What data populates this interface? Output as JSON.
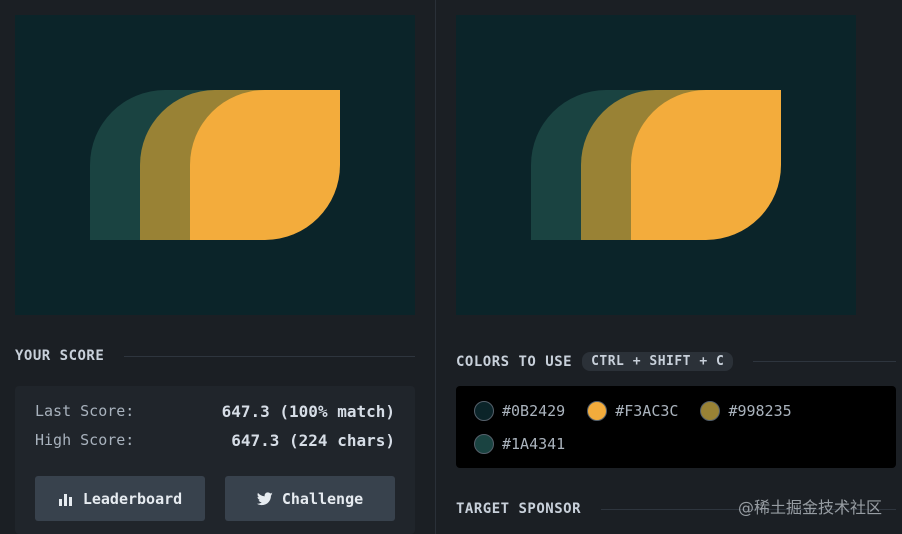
{
  "colors": {
    "bg": "#0B2429",
    "c1": "#1A4341",
    "c2": "#998235",
    "c3": "#F3AC3C"
  },
  "score": {
    "title": "YOUR SCORE",
    "last_label": "Last Score:",
    "last_value": "647.3 (100% match)",
    "high_label": "High Score:",
    "high_value": "647.3 (224 chars)"
  },
  "buttons": {
    "leaderboard": "Leaderboard",
    "challenge": "Challenge"
  },
  "palette": {
    "title": "COLORS TO USE",
    "shortcut": "CTRL + SHIFT + C",
    "items": [
      "#0B2429",
      "#F3AC3C",
      "#998235",
      "#1A4341"
    ]
  },
  "sponsor": {
    "title": "TARGET SPONSOR"
  },
  "watermark": "@稀土掘金技术社区"
}
